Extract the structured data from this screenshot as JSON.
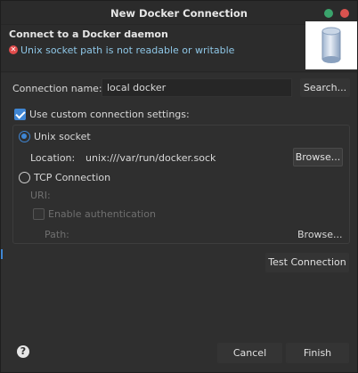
{
  "window": {
    "title": "New Docker Connection"
  },
  "header": {
    "title": "Connect to a Docker daemon",
    "message": "Unix socket path is not readable or writable",
    "error_icon_glyph": "✕"
  },
  "connection_name": {
    "label": "Connection name:",
    "value": "local docker",
    "search_button": "Search..."
  },
  "custom_settings": {
    "label": "Use custom connection settings:",
    "checked": true
  },
  "unix_socket": {
    "radio_label": "Unix socket",
    "selected": true,
    "location_label": "Location:",
    "location_value": "unix:///var/run/docker.sock",
    "browse_button": "Browse..."
  },
  "tcp": {
    "radio_label": "TCP Connection",
    "selected": false,
    "uri_label": "URI:",
    "uri_value": "",
    "enable_auth_label": "Enable authentication",
    "path_label": "Path:",
    "path_value": "",
    "browse_button": "Browse..."
  },
  "actions": {
    "test_connection": "Test Connection",
    "cancel": "Cancel",
    "finish": "Finish",
    "help_glyph": "?"
  },
  "icons": {
    "logo": "docker-cylinder-icon",
    "help": "help-icon",
    "error": "error-icon"
  },
  "colors": {
    "accent": "#3f86d4",
    "error": "#e14c4c",
    "message_text": "#8ec6e6",
    "background": "#2f2f2f"
  }
}
